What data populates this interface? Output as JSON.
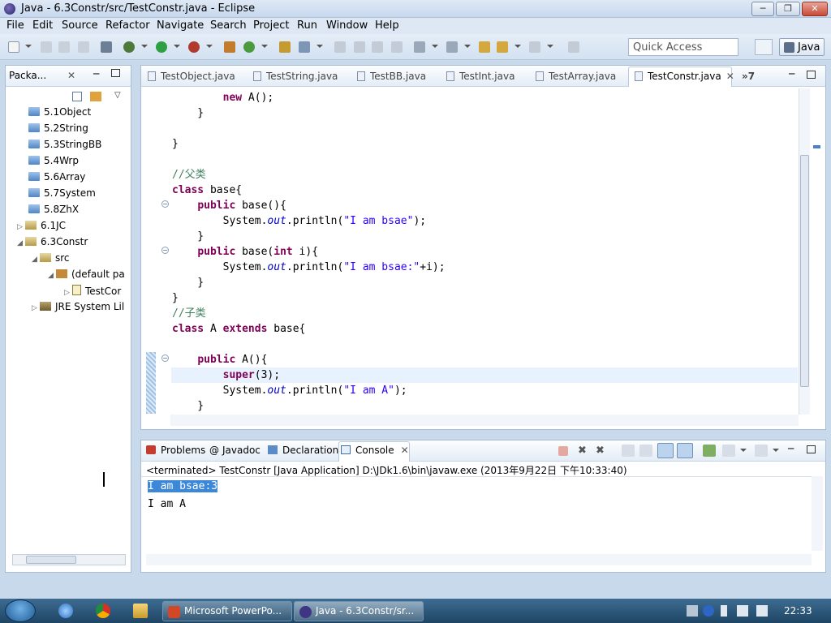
{
  "window": {
    "title": "Java - 6.3Constr/src/TestConstr.java - Eclipse",
    "minimize": "─",
    "maximize": "❐",
    "close": "✕"
  },
  "menu": [
    "File",
    "Edit",
    "Source",
    "Refactor",
    "Navigate",
    "Search",
    "Project",
    "Run",
    "Window",
    "Help"
  ],
  "toolbar": {
    "quick_access_placeholder": "Quick Access",
    "perspective": "Java"
  },
  "package_explorer": {
    "tab_label": "Packa...",
    "items": [
      {
        "label": "5.1Object",
        "type": "folder"
      },
      {
        "label": "5.2String",
        "type": "folder"
      },
      {
        "label": "5.3StringBB",
        "type": "folder"
      },
      {
        "label": "5.4Wrp",
        "type": "folder"
      },
      {
        "label": "5.6Array",
        "type": "folder"
      },
      {
        "label": "5.7System",
        "type": "folder"
      },
      {
        "label": "5.8ZhX",
        "type": "folder"
      },
      {
        "label": "6.1JC",
        "type": "project"
      },
      {
        "label": "6.3Constr",
        "type": "project"
      },
      {
        "label": "src",
        "type": "srcfolder"
      },
      {
        "label": "(default pa",
        "type": "package"
      },
      {
        "label": "TestCor",
        "type": "javafile"
      },
      {
        "label": "JRE System Lil",
        "type": "library"
      }
    ]
  },
  "editor": {
    "tabs": [
      "TestObject.java",
      "TestString.java",
      "TestBB.java",
      "TestInt.java",
      "TestArray.java",
      "TestConstr.java"
    ],
    "active_tab": "TestConstr.java",
    "overflow": "»7"
  },
  "console": {
    "tabs": [
      "Problems",
      "Javadoc",
      "Declaration",
      "Console"
    ],
    "active_tab": "Console",
    "status": "<terminated> TestConstr [Java Application] D:\\JDk1.6\\bin\\javaw.exe (2013年9月22日 下午10:33:40)",
    "output": [
      "I am bsae:3",
      "I am A"
    ]
  },
  "taskbar": {
    "items": [
      "Microsoft PowerPo...",
      "Java - 6.3Constr/sr..."
    ],
    "clock": "22:33"
  },
  "colors": {
    "keyword": "#7f0055",
    "comment": "#3f7f5f",
    "string": "#2a00ff",
    "field": "#0000c0",
    "selection": "#3d87d8"
  }
}
